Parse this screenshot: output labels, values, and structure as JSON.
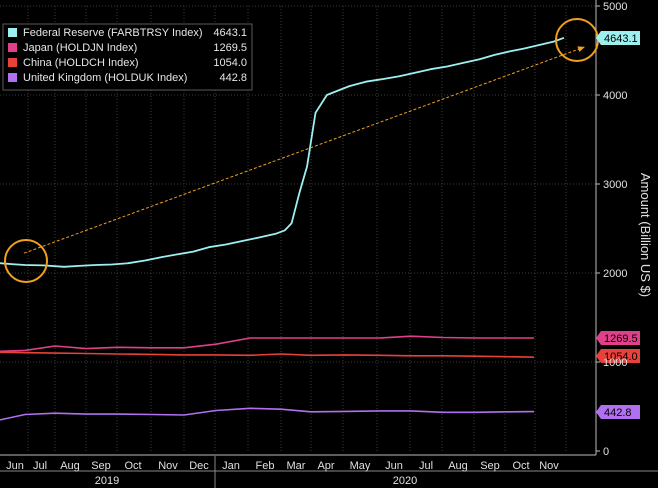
{
  "chart_data": {
    "type": "line",
    "ylabel": "Amount (Billion US $)",
    "y_axis": {
      "min": 0,
      "max": 5000,
      "ticks": [
        0,
        1000,
        2000,
        3000,
        4000,
        5000
      ],
      "position": "right"
    },
    "x_axis": {
      "months": [
        "Jun",
        "Jul",
        "Aug",
        "Sep",
        "Oct",
        "Nov",
        "Dec",
        "Jan",
        "Feb",
        "Mar",
        "Apr",
        "May",
        "Jun",
        "Jul",
        "Aug",
        "Sep",
        "Oct",
        "Nov"
      ],
      "years": [
        {
          "label": "2019",
          "start_month": "Jun",
          "end_month": "Dec"
        },
        {
          "label": "2020",
          "start_month": "Jan",
          "end_month": "Nov"
        }
      ]
    },
    "grid": true,
    "legend": {
      "placement": "top-left",
      "entries": [
        {
          "name": "Federal Reserve (FARBTRSY Index)",
          "value": "4643.1",
          "color": "#9ef0f0"
        },
        {
          "name": "Japan (HOLDJN Index)",
          "value": "1269.5",
          "color": "#e0408a"
        },
        {
          "name": "China (HOLDCH Index)",
          "value": "1054.0",
          "color": "#e8403a"
        },
        {
          "name": "United Kingdom (HOLDUK Index)",
          "value": "442.8",
          "color": "#b070f0"
        }
      ]
    },
    "series": [
      {
        "name": "Federal Reserve (FARBTRSY Index)",
        "color": "#9ef0f0",
        "last_label": "4643.1",
        "points": [
          [
            "2019-06-01",
            2110
          ],
          [
            "2019-06-15",
            2100
          ],
          [
            "2019-07-01",
            2090
          ],
          [
            "2019-07-20",
            2085
          ],
          [
            "2019-08-10",
            2070
          ],
          [
            "2019-08-25",
            2080
          ],
          [
            "2019-09-10",
            2090
          ],
          [
            "2019-09-25",
            2095
          ],
          [
            "2019-10-10",
            2110
          ],
          [
            "2019-10-25",
            2140
          ],
          [
            "2019-11-10",
            2180
          ],
          [
            "2019-11-25",
            2210
          ],
          [
            "2019-12-10",
            2240
          ],
          [
            "2019-12-25",
            2290
          ],
          [
            "2020-01-10",
            2320
          ],
          [
            "2020-01-25",
            2360
          ],
          [
            "2020-02-10",
            2400
          ],
          [
            "2020-02-25",
            2440
          ],
          [
            "2020-03-05",
            2480
          ],
          [
            "2020-03-12",
            2560
          ],
          [
            "2020-03-20",
            2900
          ],
          [
            "2020-03-28",
            3200
          ],
          [
            "2020-04-05",
            3800
          ],
          [
            "2020-04-15",
            4000
          ],
          [
            "2020-04-25",
            4050
          ],
          [
            "2020-05-05",
            4100
          ],
          [
            "2020-05-20",
            4150
          ],
          [
            "2020-06-05",
            4180
          ],
          [
            "2020-06-20",
            4210
          ],
          [
            "2020-07-05",
            4250
          ],
          [
            "2020-07-20",
            4290
          ],
          [
            "2020-08-05",
            4320
          ],
          [
            "2020-08-20",
            4360
          ],
          [
            "2020-09-05",
            4400
          ],
          [
            "2020-09-20",
            4450
          ],
          [
            "2020-10-05",
            4490
          ],
          [
            "2020-10-20",
            4520
          ],
          [
            "2020-11-05",
            4560
          ],
          [
            "2020-11-20",
            4600
          ],
          [
            "2020-11-30",
            4643.1
          ]
        ]
      },
      {
        "name": "Japan (HOLDJN Index)",
        "color": "#e0408a",
        "last_label": "1269.5",
        "points": [
          [
            "2019-06-01",
            1120
          ],
          [
            "2019-07-01",
            1130
          ],
          [
            "2019-08-01",
            1180
          ],
          [
            "2019-09-01",
            1150
          ],
          [
            "2019-10-01",
            1165
          ],
          [
            "2019-11-01",
            1160
          ],
          [
            "2019-12-01",
            1160
          ],
          [
            "2020-01-01",
            1200
          ],
          [
            "2020-02-01",
            1270
          ],
          [
            "2020-03-01",
            1270
          ],
          [
            "2020-04-01",
            1270
          ],
          [
            "2020-05-01",
            1270
          ],
          [
            "2020-06-01",
            1270
          ],
          [
            "2020-07-01",
            1290
          ],
          [
            "2020-08-01",
            1275
          ],
          [
            "2020-09-01",
            1270
          ],
          [
            "2020-10-01",
            1270
          ],
          [
            "2020-11-01",
            1269.5
          ]
        ]
      },
      {
        "name": "China (HOLDCH Index)",
        "color": "#e8403a",
        "last_label": "1054.0",
        "points": [
          [
            "2019-06-01",
            1110
          ],
          [
            "2019-07-01",
            1105
          ],
          [
            "2019-08-01",
            1100
          ],
          [
            "2019-09-01",
            1095
          ],
          [
            "2019-10-01",
            1090
          ],
          [
            "2019-11-01",
            1085
          ],
          [
            "2019-12-01",
            1080
          ],
          [
            "2020-01-01",
            1080
          ],
          [
            "2020-02-01",
            1075
          ],
          [
            "2020-03-01",
            1090
          ],
          [
            "2020-04-01",
            1075
          ],
          [
            "2020-05-01",
            1080
          ],
          [
            "2020-06-01",
            1075
          ],
          [
            "2020-07-01",
            1070
          ],
          [
            "2020-08-01",
            1070
          ],
          [
            "2020-09-01",
            1065
          ],
          [
            "2020-10-01",
            1060
          ],
          [
            "2020-11-01",
            1054.0
          ]
        ]
      },
      {
        "name": "United Kingdom (HOLDUK Index)",
        "color": "#b070f0",
        "last_label": "442.8",
        "points": [
          [
            "2019-06-01",
            350
          ],
          [
            "2019-07-01",
            410
          ],
          [
            "2019-08-01",
            425
          ],
          [
            "2019-09-01",
            415
          ],
          [
            "2019-10-01",
            415
          ],
          [
            "2019-11-01",
            410
          ],
          [
            "2019-12-01",
            405
          ],
          [
            "2020-01-01",
            455
          ],
          [
            "2020-02-01",
            480
          ],
          [
            "2020-03-01",
            470
          ],
          [
            "2020-04-01",
            440
          ],
          [
            "2020-05-01",
            445
          ],
          [
            "2020-06-01",
            450
          ],
          [
            "2020-07-01",
            450
          ],
          [
            "2020-08-01",
            435
          ],
          [
            "2020-09-01",
            435
          ],
          [
            "2020-10-01",
            440
          ],
          [
            "2020-11-01",
            442.8
          ]
        ]
      }
    ],
    "annotations": {
      "trend_arrow": {
        "from": [
          "2019-06-01",
          2110
        ],
        "to": [
          "2020-12-01",
          4560
        ],
        "color": "#f0a020",
        "style": "dashed"
      },
      "circles": [
        {
          "at": [
            "2019-06-01",
            2110
          ],
          "color": "#f0a020"
        },
        {
          "at": [
            "2020-12-01",
            4643.1
          ],
          "color": "#f0a020"
        }
      ]
    }
  }
}
